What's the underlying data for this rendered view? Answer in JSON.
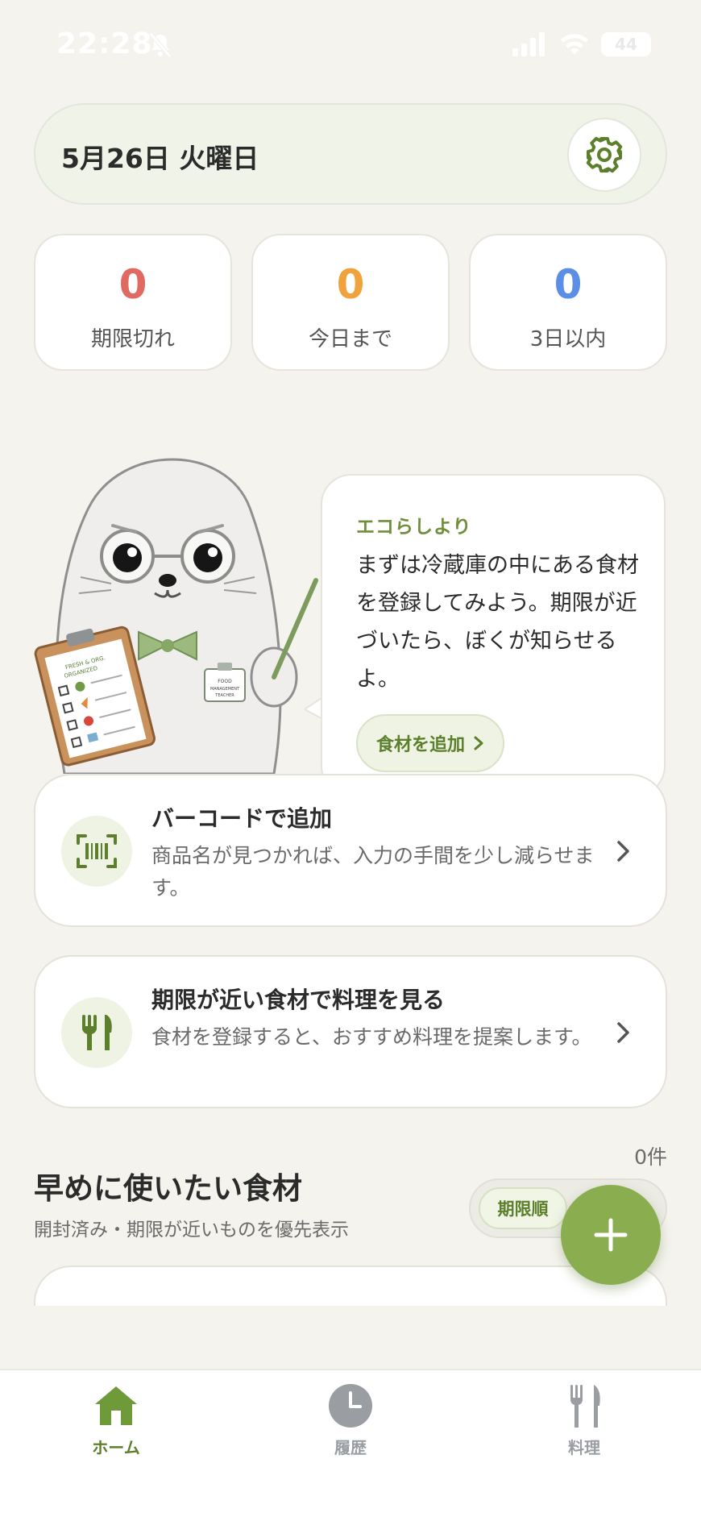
{
  "status_bar": {
    "time": "22:28",
    "battery": "44"
  },
  "header": {
    "date": "5月26日 火曜日"
  },
  "stats": [
    {
      "value": "0",
      "label": "期限切れ",
      "color": "#e06a62"
    },
    {
      "value": "0",
      "label": "今日まで",
      "color": "#f0a33c"
    },
    {
      "value": "0",
      "label": "3日以内",
      "color": "#5b8ee6"
    }
  ],
  "mascot": {
    "clipboard_text": "FRESH & ORG. ORGANIZED",
    "badge_text": "FOOD MANAGEMENT TEACHER"
  },
  "bubble": {
    "from": "エコらしより",
    "message": "まずは冷蔵庫の中にある食材を登録してみよう。期限が近づいたら、ぼくが知らせるよ。",
    "button_label": "食材を追加"
  },
  "actions": [
    {
      "title": "バーコードで追加",
      "description": "商品名が見つかれば、入力の手間を少し減らせます。",
      "icon": "barcode-icon"
    },
    {
      "title": "期限が近い食材で料理を見る",
      "description": "食材を登録すると、おすすめ料理を提案します。",
      "icon": "utensils-icon"
    }
  ],
  "section": {
    "count": "0件",
    "title": "早めに使いたい食材",
    "subtitle": "開封済み・期限が近いものを優先表示",
    "sort_label": "期限順"
  },
  "tabs": [
    {
      "label": "ホーム",
      "icon": "home-icon",
      "active": true
    },
    {
      "label": "履歴",
      "icon": "clock-icon",
      "active": false
    },
    {
      "label": "料理",
      "icon": "fork-knife-icon",
      "active": false
    }
  ],
  "colors": {
    "accent": "#8aae4f",
    "accent_dark": "#5c7f2c",
    "inactive": "#9a9ea3"
  }
}
